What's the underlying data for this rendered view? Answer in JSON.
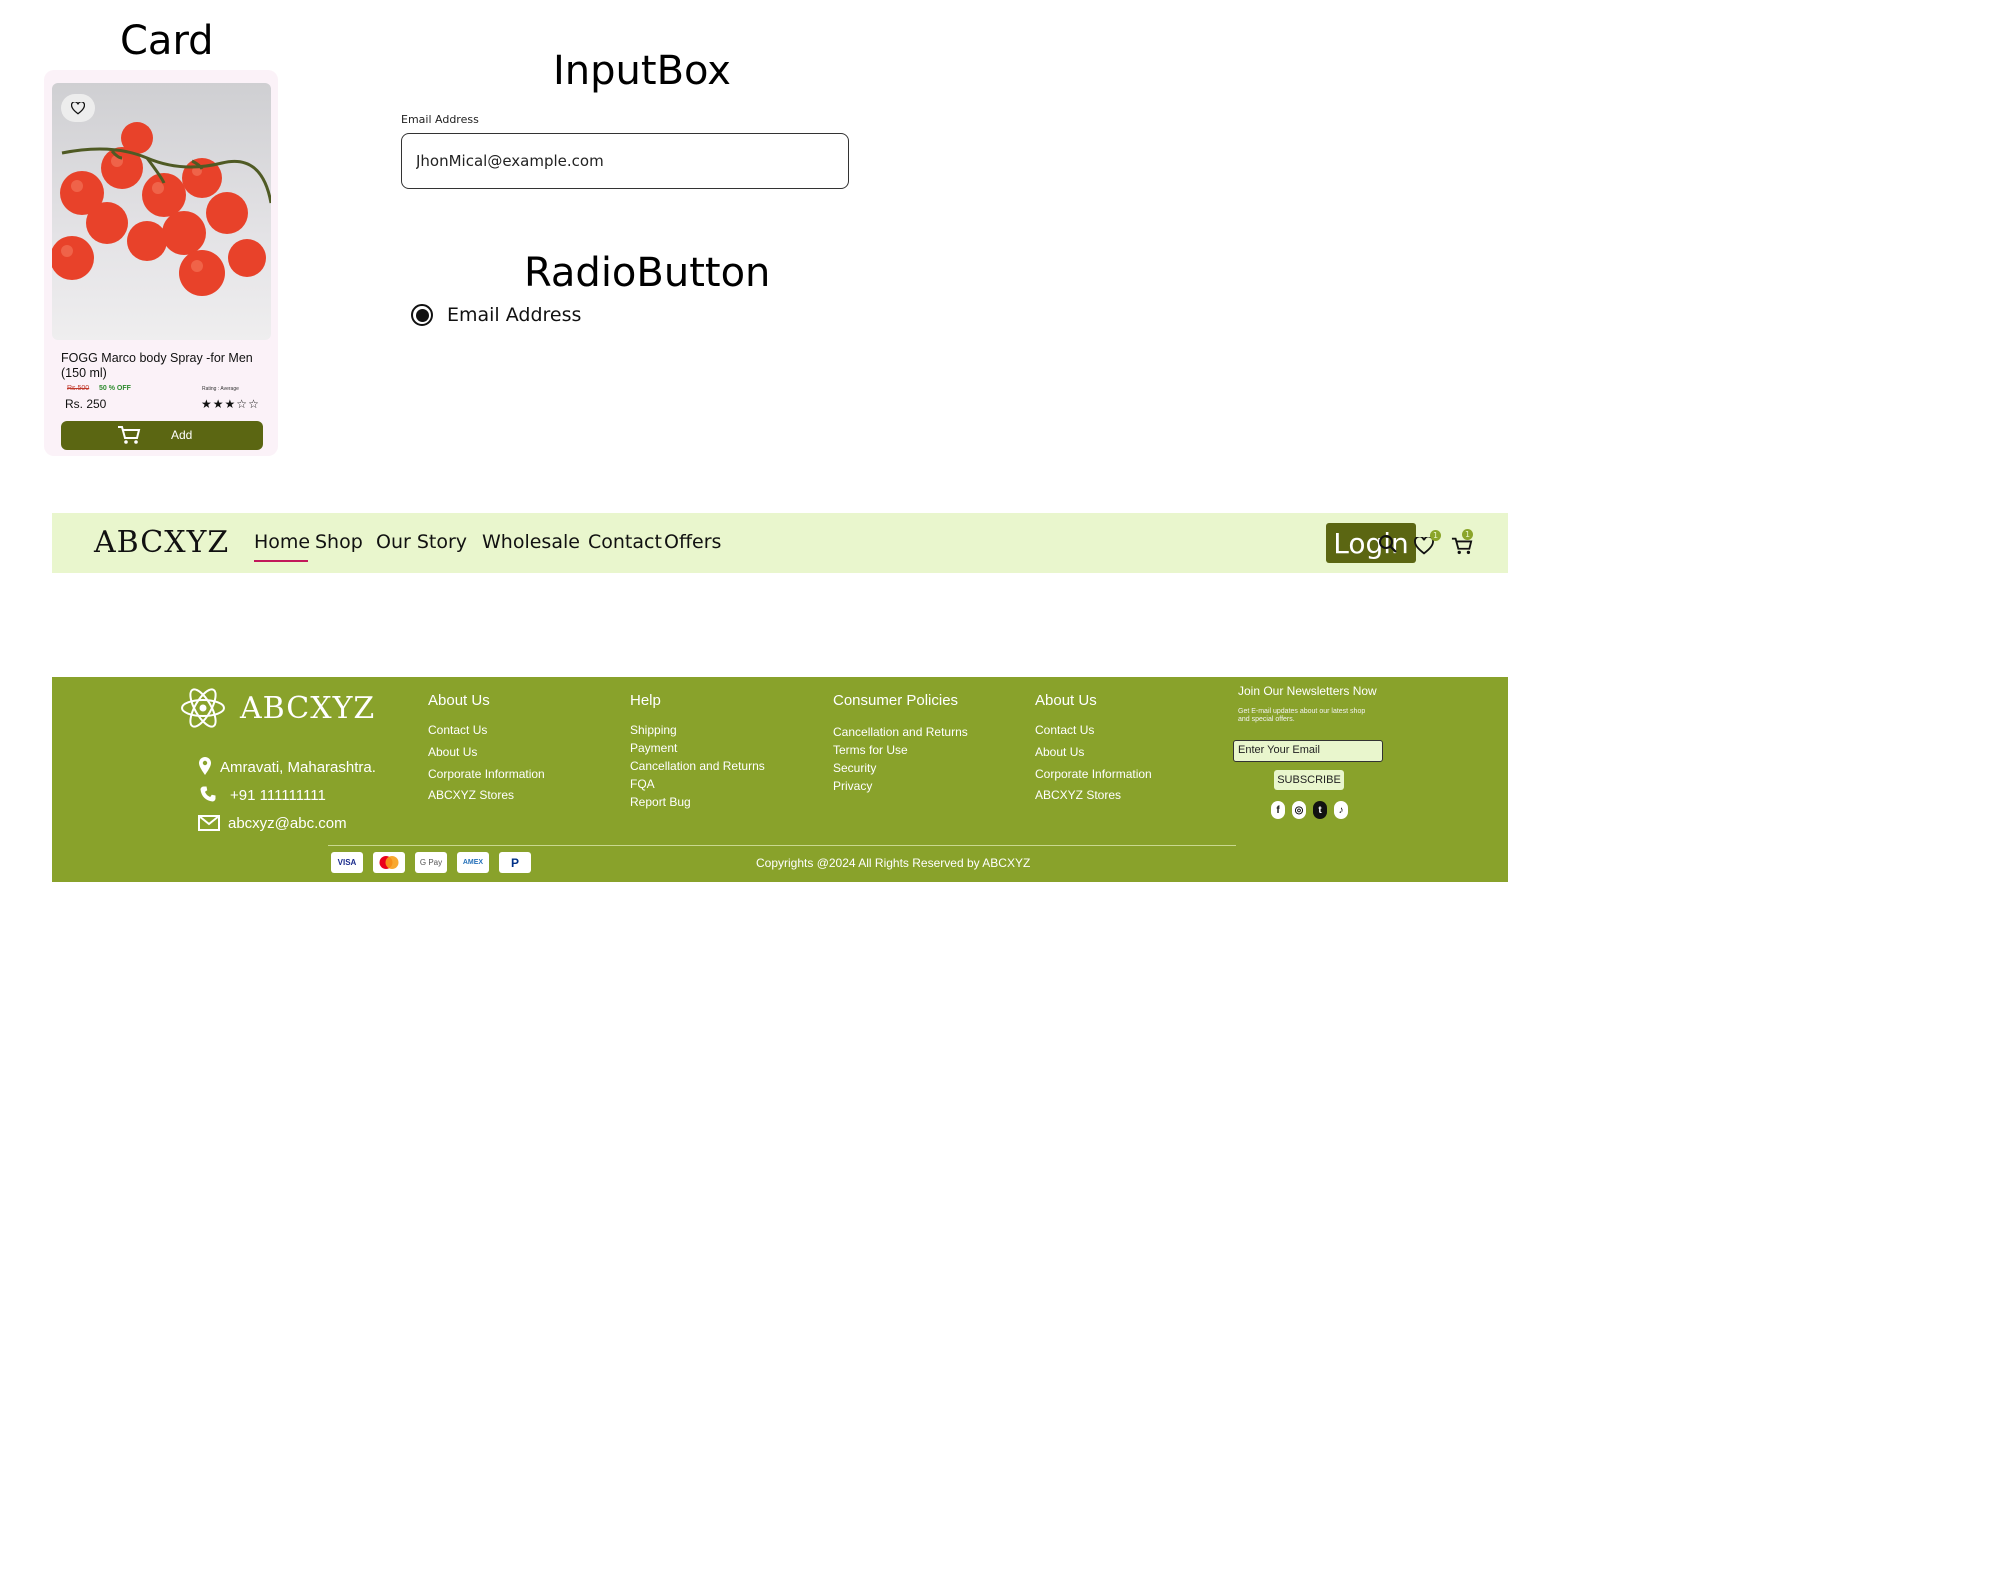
{
  "sections": {
    "card_title": "Card",
    "input_title": "InputBox",
    "radio_title": "RadioButton"
  },
  "card": {
    "product_name": "FOGG Marco body Spray -for Men (150 ml)",
    "old_price": "Rs.500",
    "discount": "50 % OFF",
    "rating_label": "Rating : Average",
    "price": "Rs. 250",
    "rating_filled": 3,
    "rating_total": 5,
    "add_label": "Add",
    "image_icon": "tomatoes-photo",
    "favorite_icon": "heart-icon",
    "cart_icon": "cart-icon"
  },
  "input": {
    "label": "Email Address",
    "value": "JhonMical@example.com"
  },
  "radio": {
    "label": "Email Address",
    "checked": true
  },
  "navbar": {
    "logo": "ABCXYZ",
    "items": [
      "Home",
      "Shop",
      "Our Story",
      "Wholesale",
      "Contact",
      "Offers"
    ],
    "active": "Home",
    "login_label": "Login",
    "wishlist_count": "1",
    "cart_count": "1"
  },
  "footer": {
    "logo": "ABCXYZ",
    "address": "Amravati, Maharashtra.",
    "phone": "+91 111111111",
    "email": "abcxyz@abc.com",
    "columns": [
      {
        "title": "About Us",
        "links": [
          "Contact Us",
          "About Us",
          "Corporate Information",
          "ABCXYZ Stores"
        ]
      },
      {
        "title": "Help",
        "links": [
          "Shipping",
          "Payment",
          "Cancellation and Returns",
          "FQA",
          "Report Bug"
        ]
      },
      {
        "title": "Consumer Policies",
        "links": [
          "Cancellation and Returns",
          "Terms for Use",
          "Security",
          "Privacy"
        ]
      },
      {
        "title": "About Us",
        "links": [
          "Contact Us",
          "About Us",
          "Corporate Information",
          "ABCXYZ Stores"
        ]
      }
    ],
    "newsletter": {
      "title": "Join Our Newsletters Now",
      "description": "Get E-mail updates about our latest shop and special offers.",
      "placeholder": "Enter Your Email",
      "subscribe_label": "SUBSCRIBE"
    },
    "payments": [
      "VISA",
      "Mastercard",
      "G Pay",
      "AMEX",
      "PayPal"
    ],
    "copyright": "Copyrights @2024 All Rights Reserved by ABCXYZ"
  },
  "colors": {
    "brand_dark": "#5b6612",
    "footer_bg": "#89a22b",
    "navbar_bg": "#e9f6cd",
    "active_underline": "#c2185b"
  }
}
